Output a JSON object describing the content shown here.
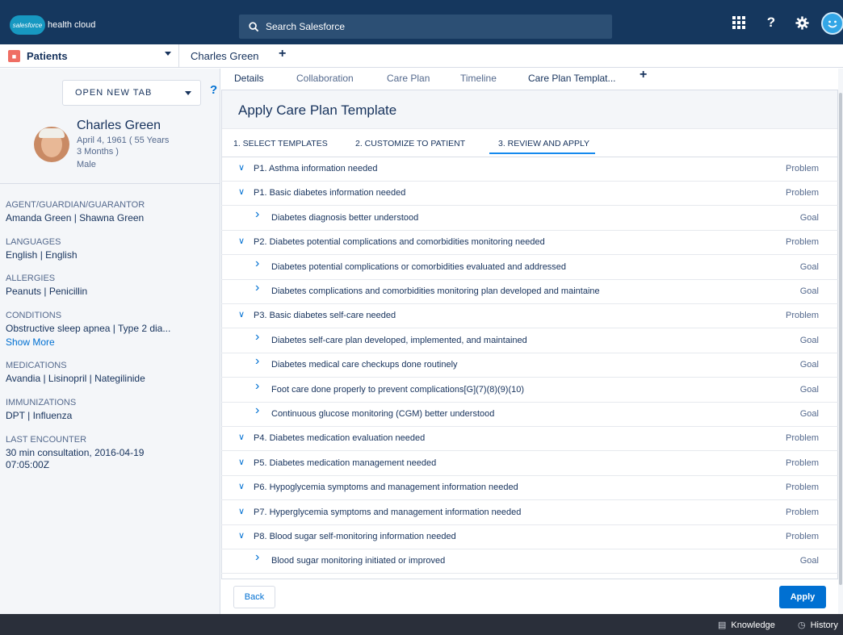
{
  "header": {
    "logo_text": "salesforce",
    "app_name": "health cloud",
    "search_placeholder": "Search Salesforce",
    "icons": [
      "app-launcher-icon",
      "help-icon",
      "setup-gear-icon",
      "user-avatar-icon"
    ]
  },
  "workspace": {
    "object_tab": "Patients",
    "record_tab": "Charles Green"
  },
  "sidebar": {
    "open_new_tab": "OPEN NEW TAB",
    "help": "?",
    "patient": {
      "name": "Charles Green",
      "dob_line1": "April 4, 1961 ( 55 Years",
      "dob_line2": "3 Months )",
      "gender": "Male"
    },
    "fields": [
      {
        "label": "AGENT/GUARDIAN/GUARANTOR",
        "value": "Amanda Green | Shawna Green"
      },
      {
        "label": "LANGUAGES",
        "value": "English | English"
      },
      {
        "label": "ALLERGIES",
        "value": "Peanuts | Penicillin"
      },
      {
        "label": "CONDITIONS",
        "value": "Obstructive sleep apnea | Type 2 dia..."
      },
      {
        "label": "MEDICATIONS",
        "value": "Avandia | Lisinopril | Nategilinide"
      },
      {
        "label": "IMMUNIZATIONS",
        "value": "DPT | Influenza"
      },
      {
        "label": "LAST ENCOUNTER",
        "value": "30 min consultation, 2016-04-19"
      }
    ],
    "show_more": "Show More",
    "last_encounter_time": "07:05:00Z"
  },
  "record_tabs": [
    "Details",
    "Collaboration",
    "Care Plan",
    "Timeline",
    "Care Plan Templat..."
  ],
  "panel": {
    "title": "Apply Care Plan Template",
    "steps": [
      "1. SELECT TEMPLATES",
      "2. CUSTOMIZE TO PATIENT",
      "3. REVIEW AND APPLY"
    ],
    "rows": [
      {
        "label": "P1. Asthma information needed",
        "type": "Problem",
        "level": 0,
        "expanded": true
      },
      {
        "label": "P1. Basic diabetes information needed",
        "type": "Problem",
        "level": 0,
        "expanded": true
      },
      {
        "label": "Diabetes diagnosis better understood",
        "type": "Goal",
        "level": 1,
        "expanded": false
      },
      {
        "label": "P2. Diabetes potential complications and comorbidities monitoring needed",
        "type": "Problem",
        "level": 0,
        "expanded": true
      },
      {
        "label": "Diabetes potential complications or comorbidities evaluated and addressed",
        "type": "Goal",
        "level": 1,
        "expanded": false
      },
      {
        "label": "Diabetes complications and comorbidities monitoring plan developed and maintaine",
        "type": "Goal",
        "level": 1,
        "expanded": false
      },
      {
        "label": "P3. Basic diabetes self-care needed",
        "type": "Problem",
        "level": 0,
        "expanded": true
      },
      {
        "label": "Diabetes self-care plan developed, implemented, and maintained",
        "type": "Goal",
        "level": 1,
        "expanded": false
      },
      {
        "label": "Diabetes medical care checkups done routinely",
        "type": "Goal",
        "level": 1,
        "expanded": false
      },
      {
        "label": "Foot care done properly to prevent complications[G](7)(8)(9)(10)",
        "type": "Goal",
        "level": 1,
        "expanded": false
      },
      {
        "label": "Continuous glucose monitoring (CGM) better understood",
        "type": "Goal",
        "level": 1,
        "expanded": false
      },
      {
        "label": "P4. Diabetes medication evaluation needed",
        "type": "Problem",
        "level": 0,
        "expanded": true
      },
      {
        "label": "P5. Diabetes medication management needed",
        "type": "Problem",
        "level": 0,
        "expanded": true
      },
      {
        "label": "P6. Hypoglycemia symptoms and management information needed",
        "type": "Problem",
        "level": 0,
        "expanded": true
      },
      {
        "label": "P7. Hyperglycemia symptoms and management information needed",
        "type": "Problem",
        "level": 0,
        "expanded": true
      },
      {
        "label": "P8. Blood sugar self-monitoring information needed",
        "type": "Problem",
        "level": 0,
        "expanded": true
      },
      {
        "label": "Blood sugar monitoring initiated or improved",
        "type": "Goal",
        "level": 1,
        "expanded": false
      }
    ],
    "back_label": "Back",
    "apply_label": "Apply"
  },
  "utility_bar": {
    "knowledge": "Knowledge",
    "history": "History"
  },
  "colors": {
    "header_bg": "#15375e",
    "brand_blue": "#0070d2",
    "active_tab": "#1589ee"
  }
}
